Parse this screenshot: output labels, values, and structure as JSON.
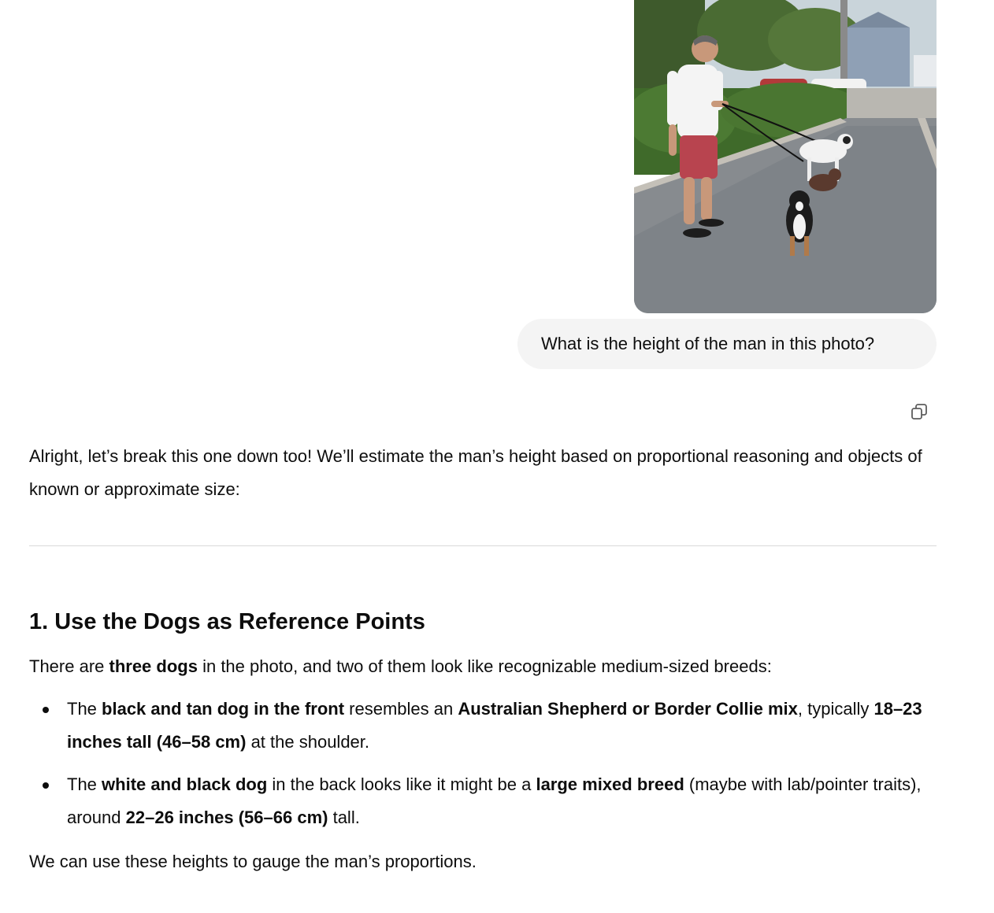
{
  "user_message": {
    "photo_alt": "Man walking three dogs on a gravel driveway",
    "text": "What is the height of the man in this photo?"
  },
  "assistant": {
    "copy_icon": "copy-icon",
    "intro": "Alright, let’s break this one down too! We’ll estimate the man’s height based on proportional reasoning and objects of known or approximate size:",
    "section1": {
      "heading": "1. Use the Dogs as Reference Points",
      "lead": {
        "t1": "There are ",
        "b1": "three dogs",
        "t2": " in the photo, and two of them look like recognizable medium-sized breeds:"
      },
      "bullets": [
        {
          "t1": "The ",
          "b1": "black and tan dog in the front",
          "t2": " resembles an ",
          "b2": "Australian Shepherd or Border Collie mix",
          "t3": ", typically ",
          "b3": "18–23 inches tall (46–58 cm)",
          "t4": " at the shoulder."
        },
        {
          "t1": "The ",
          "b1": "white and black dog",
          "t2": " in the back looks like it might be a ",
          "b2": "large mixed breed",
          "t3": " (maybe with lab/pointer traits), around ",
          "b3": "22–26 inches (56–66 cm)",
          "t4": " tall."
        }
      ],
      "closing": "We can use these heights to gauge the man’s proportions."
    }
  },
  "colors": {
    "bubble_bg": "#f4f4f4",
    "text": "#0d0d0d",
    "divider": "#d9d9d9"
  }
}
